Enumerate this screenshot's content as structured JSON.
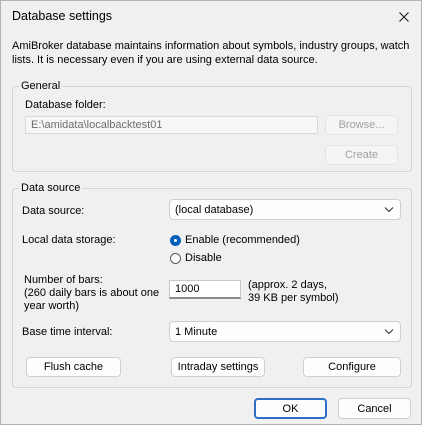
{
  "window": {
    "title": "Database settings",
    "intro": "AmiBroker database maintains information about symbols, industry groups, watch lists. It is necessary even if you are using external data source."
  },
  "general": {
    "group_title": "General",
    "folder_label": "Database folder:",
    "folder_value": "E:\\amidata\\localbacktest01",
    "browse_label": "Browse...",
    "create_label": "Create"
  },
  "data_source": {
    "group_title": "Data source",
    "source_label": "Data source:",
    "source_value": "(local database)",
    "storage_label": "Local data storage:",
    "enable_label": "Enable (recommended)",
    "disable_label": "Disable",
    "bars_label_line1": "Number of bars:",
    "bars_label_line2": "(260 daily bars is about one",
    "bars_label_line3": "year worth)",
    "bars_value": "1000",
    "bars_note_line1": "(approx. 2 days,",
    "bars_note_line2": "39 KB per symbol)",
    "interval_label": "Base time interval:",
    "interval_value": "1 Minute",
    "flush_label": "Flush cache",
    "intraday_label": "Intraday settings",
    "configure_label": "Configure"
  },
  "footer": {
    "ok_label": "OK",
    "cancel_label": "Cancel"
  },
  "icons": {
    "close": "close-icon",
    "chevron": "chevron-down-icon"
  },
  "colors": {
    "accent": "#005fb8",
    "default_button_border": "#2c6ec5"
  }
}
